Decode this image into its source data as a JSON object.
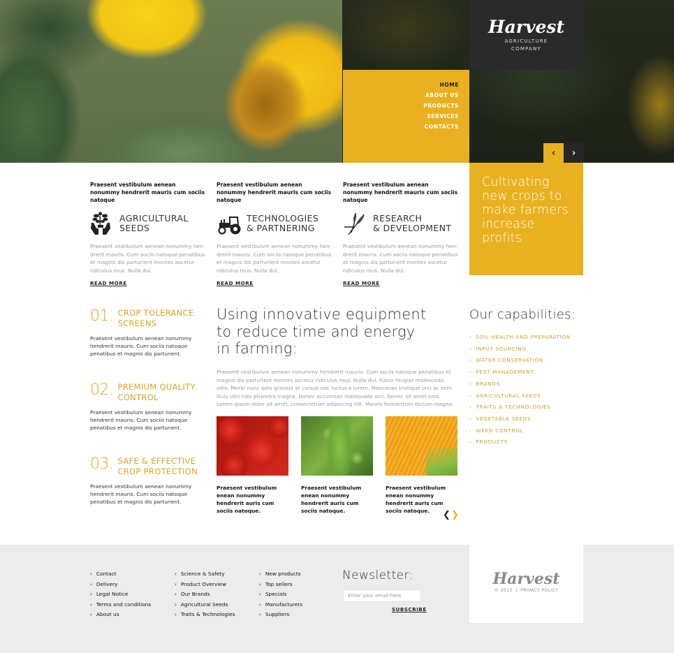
{
  "brand": {
    "name": "Harvest",
    "tagline_line1": "AGRICULTURE",
    "tagline_line2": "COMPANY"
  },
  "nav": {
    "items": [
      {
        "label": "HOME",
        "active": true
      },
      {
        "label": "ABOUT US",
        "active": false
      },
      {
        "label": "PRODUCTS",
        "active": false
      },
      {
        "label": "SERVICES",
        "active": false
      },
      {
        "label": "CONTACTS",
        "active": false
      }
    ]
  },
  "slider": {
    "prev_icon": "‹",
    "next_icon": "›"
  },
  "features": [
    {
      "lead": "Praesent vestibulum aenean nonummy hendrerit mauris cum sociis natoque",
      "icon": "hands-plant-icon",
      "title_line1": "AGRICULTURAL",
      "title_line2": "SEEDS",
      "text": "Praesent vestibulum aenean nonummy hen-drerit mauris. Cum sociis natoque penatibus et magnis dis parturient montes ascetur ridiculus mus. Nulla dui.",
      "link": "READ MORE"
    },
    {
      "lead": "Praesent vestibulum aenean nonummy hendrerit mauris cum sociis natoque",
      "icon": "tractor-icon",
      "title_line1": "TECHNOLOGIES",
      "title_line2": "& PARTNERING",
      "text": "Praesent vestibulum aenean nonummy hen-drerit mauris. Cum sociis natoque penatibus et magnis dis parturient montes ascetur ridiculus mus. Nulla dui.",
      "link": "READ MORE"
    },
    {
      "lead": "Praesent vestibulum aenean nonummy hendrerit mauris cum sociis natoque",
      "icon": "wheat-icon",
      "title_line1": "RESEARCH",
      "title_line2": "& DEVELOPMENT",
      "text": "Praesent vestibulum aenean nonummy hen-drerit mauris. Cum sociis natoque penatibus et magnis dis parturient montes ascetur ridiculus mus. Nulla dui.",
      "link": "READ MORE"
    }
  ],
  "promo": {
    "text": "Cultivating new crops to make farmers increase profits"
  },
  "numbered": [
    {
      "num": "01.",
      "title_line1": "CROP TOLERANCE",
      "title_line2": "SCREENS",
      "text": "Praesent vestibulum aenean nonummy hendrerit mauris. Cum sociis natoque penatibus et magnis dis parturient."
    },
    {
      "num": "02.",
      "title_line1": "PREMIUM QUALITY",
      "title_line2": "CONTROL",
      "text": "Praesent vestibulum aenean nonummy hendrerit mauris. Cum sociis natoque penatibus et magnis dis parturient."
    },
    {
      "num": "03.",
      "title_line1": "SAFE & EFFECTIVE",
      "title_line2": "CROP PROTECTION",
      "text": "Praesent vestibulum aenean nonummy hendrerit mauris. Cum sociis natoque penatibus et magnis dis parturient."
    }
  ],
  "main": {
    "title_line1": "Using innovative equipment",
    "title_line2": "to reduce time and energy",
    "title_line3": "in farming:",
    "text": "Praesent vestibulum aenean nonummy hendrerit mauris. Cum sociis natoque penatibus et magnis dis parturient montes ascetur ridiculus mus. Nulla dui. Fusce feugiat malesuada odio. Morbi nunc odio gravida at cursus nec luctus a lorem. Maecenas tristique orci ac sem. Duis ultri-cies pharetra magna. Donec accumsan malesuada orci. Donec sit amet eros. Lorem ipsum dolor sit amet, consectetuer adipiscing elit. Mauris fermentum dictum magna.",
    "gallery": [
      {
        "image": "tomatoes",
        "caption": "Praesent vestibulum enean nonummy hendrerit auris cum sociis natoque."
      },
      {
        "image": "peas",
        "caption": "Praesent vestibulum enean nonummy hendrerit auris cum sociis natoque."
      },
      {
        "image": "corn",
        "caption": "Praesent vestibulum enean nonummy hendrerit auris cum sociis natoque."
      }
    ],
    "gallery_prev": "❮",
    "gallery_next": "❯"
  },
  "capabilities": {
    "title": "Our capabilities:",
    "items": [
      "SOIL HEALTH AND PREPARATION",
      "INPUT SOURCING",
      "WATER CONSERVATION",
      "PEST MANAGEMENT",
      "BRANDS",
      "AGRICULTURAL SEEDS",
      "TRAITS & TECHNOLOGIES",
      "VEGETABLE SEEDS",
      "WEED CONTROL",
      "PRODUCTS"
    ]
  },
  "footer": {
    "col1": [
      "Contact",
      "Delivery",
      "Legal Notice",
      "Terms and conditions",
      "About us"
    ],
    "col2": [
      "Science & Safety",
      "Product Overview",
      "Our Brands",
      "Agricultural Seeds",
      "Traits & Technologies"
    ],
    "col3": [
      "New products",
      "Top sellers",
      "Specials",
      "Manufacturers",
      "Suppliers"
    ],
    "newsletter_title": "Newsletter:",
    "email_placeholder": "Enter your email here",
    "email_value": "",
    "subscribe_label": "SUBSCRIBE",
    "logo": "Harvest",
    "copyright": "© 2013",
    "separator": "|",
    "privacy": "PRIVACY POLICY"
  },
  "colors": {
    "accent": "#e9b11f",
    "accent_text": "#d9a624",
    "dark": "#2a2a2a",
    "footer_bg": "#ececec"
  }
}
